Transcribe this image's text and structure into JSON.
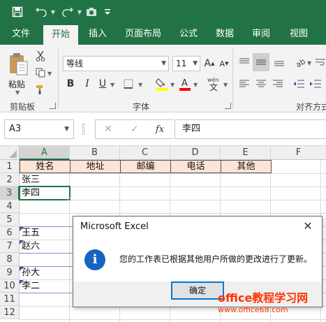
{
  "qat": {
    "save_icon": "save-icon",
    "undo_icon": "undo-icon",
    "redo_icon": "redo-icon",
    "camera_icon": "camera-icon",
    "more_icon": "customize-icon"
  },
  "tabs": [
    {
      "label": "文件"
    },
    {
      "label": "开始",
      "active": true
    },
    {
      "label": "插入"
    },
    {
      "label": "页面布局"
    },
    {
      "label": "公式"
    },
    {
      "label": "数据"
    },
    {
      "label": "审阅"
    },
    {
      "label": "视图"
    }
  ],
  "ribbon": {
    "clipboard": {
      "paste_label": "粘贴",
      "group_label": "剪贴板"
    },
    "font": {
      "font_name": "等线",
      "font_size": "11",
      "bold": "B",
      "italic": "I",
      "underline": "U",
      "grow_font": "A",
      "shrink_font": "A",
      "fill_color": "#ffff00",
      "font_color": "#ff0000",
      "group_label": "字体"
    },
    "alignment": {
      "group_label": "对齐方式"
    }
  },
  "formula_bar": {
    "name_box": "A3",
    "cancel": "✕",
    "enter": "✓",
    "fx": "fx",
    "content": "李四"
  },
  "grid": {
    "columns": [
      "A",
      "B",
      "C",
      "D",
      "E",
      "F"
    ],
    "rows": [
      "1",
      "2",
      "3",
      "4",
      "5",
      "6",
      "7",
      "8",
      "9",
      "10",
      "11",
      "12"
    ],
    "header_row": [
      "姓名",
      "地址",
      "邮编",
      "电话",
      "其他"
    ],
    "column_a": [
      "",
      "张三",
      "李四",
      "",
      "",
      "王五",
      "赵六",
      "",
      "孙大",
      "李二",
      "",
      ""
    ],
    "selected_cell": "A3",
    "header_fill": "#fce4d6",
    "accent": "#217346"
  },
  "dialog": {
    "title": "Microsoft Excel",
    "close": "✕",
    "icon": "info-icon",
    "info_glyph": "i",
    "message": "您的工作表已根据其他用户所做的更改进行了更新。",
    "ok_label": "确定"
  },
  "watermark": {
    "line1": "office教程学习网",
    "line2": "www.office68.com"
  }
}
